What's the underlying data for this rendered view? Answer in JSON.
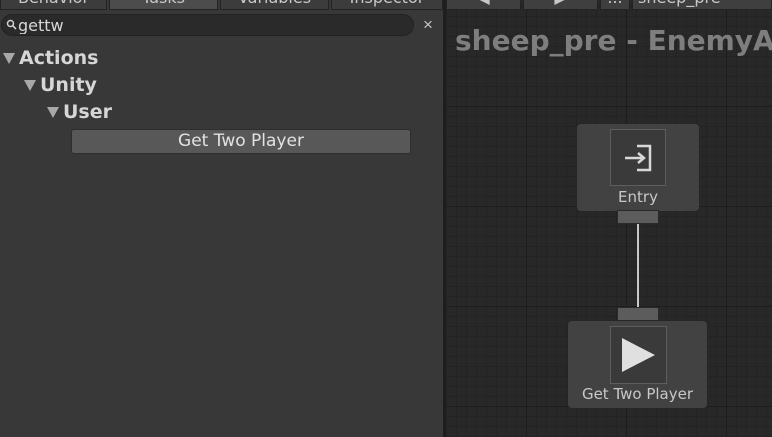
{
  "tabs": [
    {
      "label": "Behavior",
      "active": false
    },
    {
      "label": "Tasks",
      "active": true
    },
    {
      "label": "Variables",
      "active": false
    },
    {
      "label": "Inspector",
      "active": false
    }
  ],
  "search": {
    "value": "gettw",
    "clear_icon": "×"
  },
  "tree": {
    "level1": "Actions",
    "level2": "Unity",
    "level3": "User",
    "task": "Get Two Player"
  },
  "graph": {
    "toolbar": {
      "prev": "◀",
      "next": "▶",
      "more": "...",
      "tree_name": "sheep_pre"
    },
    "title": "sheep_pre - EnemyAtt",
    "entry_node": {
      "label": "Entry",
      "icon": "entry-icon"
    },
    "task_node": {
      "label": "Get Two Player",
      "icon": "play-icon"
    }
  },
  "colors": {
    "background": "#383838",
    "graph": "#282828",
    "node": "#424242",
    "connector": "#c9c9c9"
  }
}
